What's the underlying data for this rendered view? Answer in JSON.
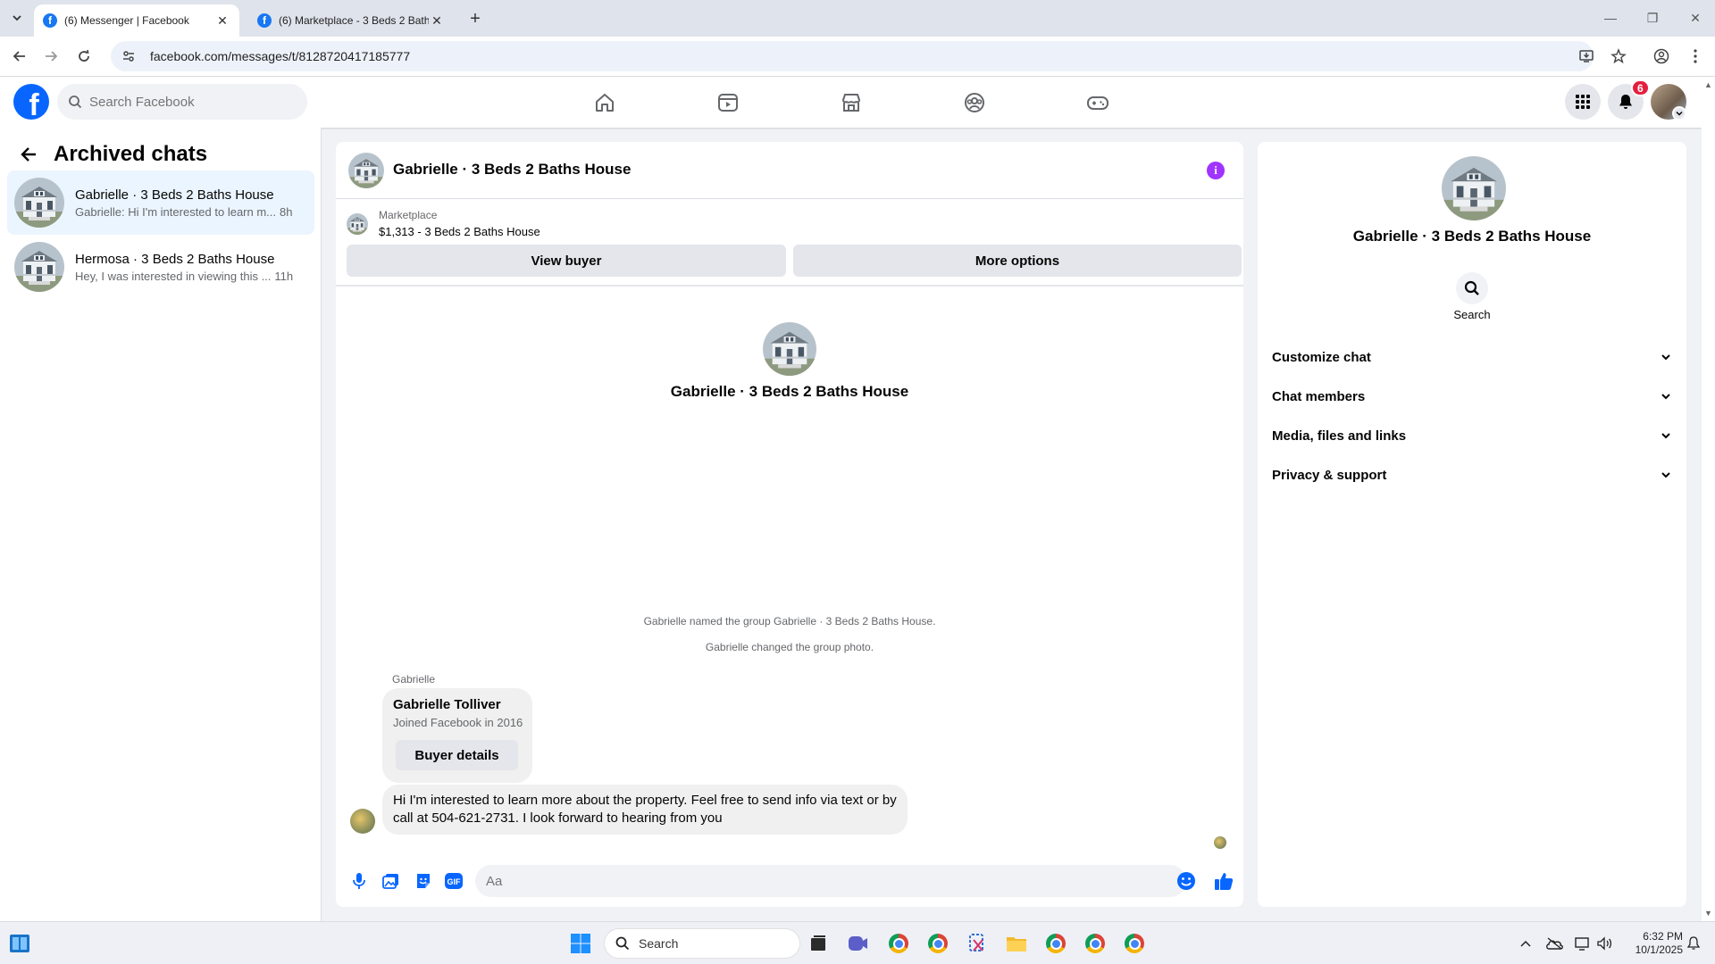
{
  "browser": {
    "tabs": [
      {
        "title": "(6) Messenger | Facebook",
        "active": true
      },
      {
        "title": "(6) Marketplace - 3 Beds 2 Bath",
        "active": false
      }
    ],
    "url": "facebook.com/messages/t/8128720417185777"
  },
  "fbnav": {
    "search_placeholder": "Search Facebook",
    "notification_count": "6"
  },
  "archived": {
    "title": "Archived chats",
    "conversations": [
      {
        "name": "Gabrielle · 3 Beds 2 Baths House",
        "snippet": "Gabrielle: Hi I'm interested to learn m...",
        "time": "8h",
        "selected": true
      },
      {
        "name": "Hermosa · 3 Beds 2 Baths House",
        "snippet": "Hey, I was interested in viewing this ...",
        "time": "11h",
        "selected": false
      }
    ]
  },
  "chat": {
    "title": "Gabrielle · 3 Beds 2 Baths House",
    "marketplace_label": "Marketplace",
    "listing": "$1,313 - 3 Beds 2 Baths House",
    "view_buyer": "View buyer",
    "more_options": "More options",
    "intro_name": "Gabrielle · 3 Beds 2 Baths House",
    "system_messages": [
      "Gabrielle named the group Gabrielle · 3 Beds 2 Baths House.",
      "Gabrielle changed the group photo."
    ],
    "sender": "Gabrielle",
    "buyer_card": {
      "name": "Gabrielle Tolliver",
      "subtitle": "Joined Facebook in 2016",
      "button": "Buyer details"
    },
    "message": "Hi I'm interested to learn more about the property. Feel free to send info via text or by call at 504-621-2731. I look forward to hearing from you",
    "composer_placeholder": "Aa"
  },
  "info_pane": {
    "name": "Gabrielle · 3 Beds 2 Baths House",
    "search_label": "Search",
    "sections": [
      "Customize chat",
      "Chat members",
      "Media, files and links",
      "Privacy & support"
    ]
  },
  "taskbar": {
    "search_placeholder": "Search",
    "time": "6:32 PM",
    "date": "10/1/2025"
  },
  "colors": {
    "facebook_blue": "#0866ff",
    "info_purple": "#a033ff",
    "badge_red": "#e41e3f",
    "selected_row": "#ebf5ff"
  }
}
